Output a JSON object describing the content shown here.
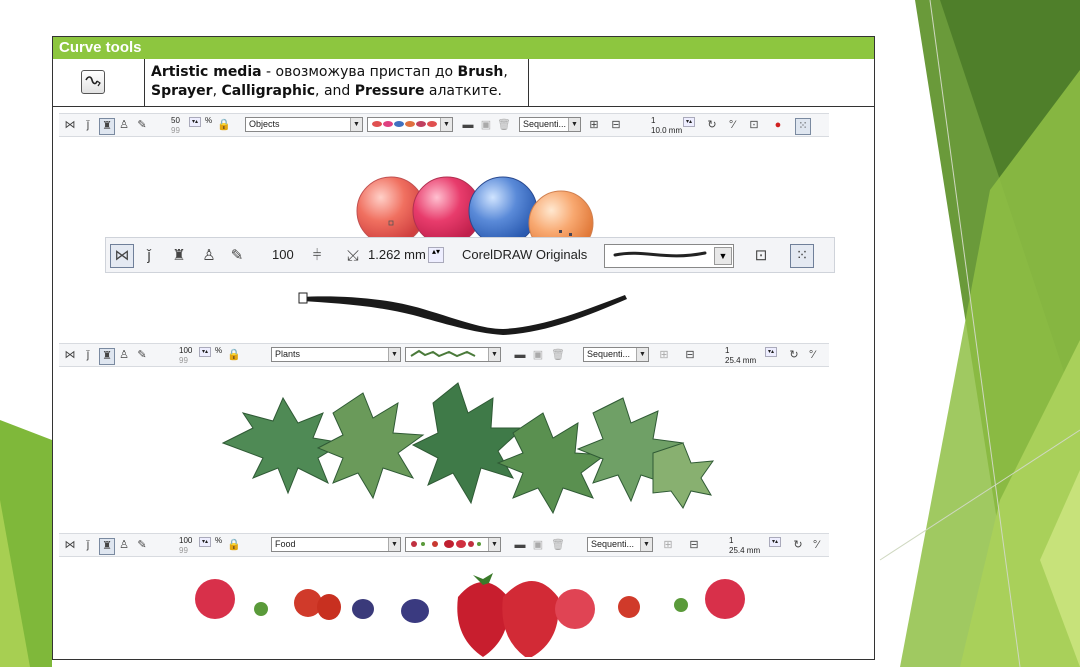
{
  "slide": {
    "title": "Curve tools",
    "tool_icon": "artistic-media-icon",
    "description": {
      "b1": "Artistic media",
      "t1": " - овозможува пристап до ",
      "b2": "Brush",
      "t2": ",",
      "b3": "Sprayer",
      "t3": ", ",
      "b4": "Calligraphic",
      "t4": ", and ",
      "b5": "Pressure",
      "t5": " алатките."
    }
  },
  "colors": {
    "green_bar": "#8dc63f",
    "deco_green_dark": "#5e8a2e",
    "deco_green_light": "#b5d96a"
  },
  "toolbar1": {
    "size_top": "50",
    "size_bottom": "99",
    "percent": "%",
    "category": "Objects",
    "order": "Sequenti...",
    "spacing_count": "1",
    "spacing_distance": "10.0 mm"
  },
  "toolbar2": {
    "smoothing": "100",
    "width": "1.262 mm",
    "preset": "CorelDRAW Originals"
  },
  "toolbar3": {
    "size_top": "100",
    "size_bottom": "99",
    "percent": "%",
    "category": "Plants",
    "order": "Sequenti...",
    "spacing_count": "1",
    "spacing_distance": "25.4 mm"
  },
  "toolbar4": {
    "size_top": "100",
    "size_bottom": "99",
    "percent": "%",
    "category": "Food",
    "order": "Sequenti...",
    "spacing_count": "1",
    "spacing_distance": "25.4 mm"
  }
}
